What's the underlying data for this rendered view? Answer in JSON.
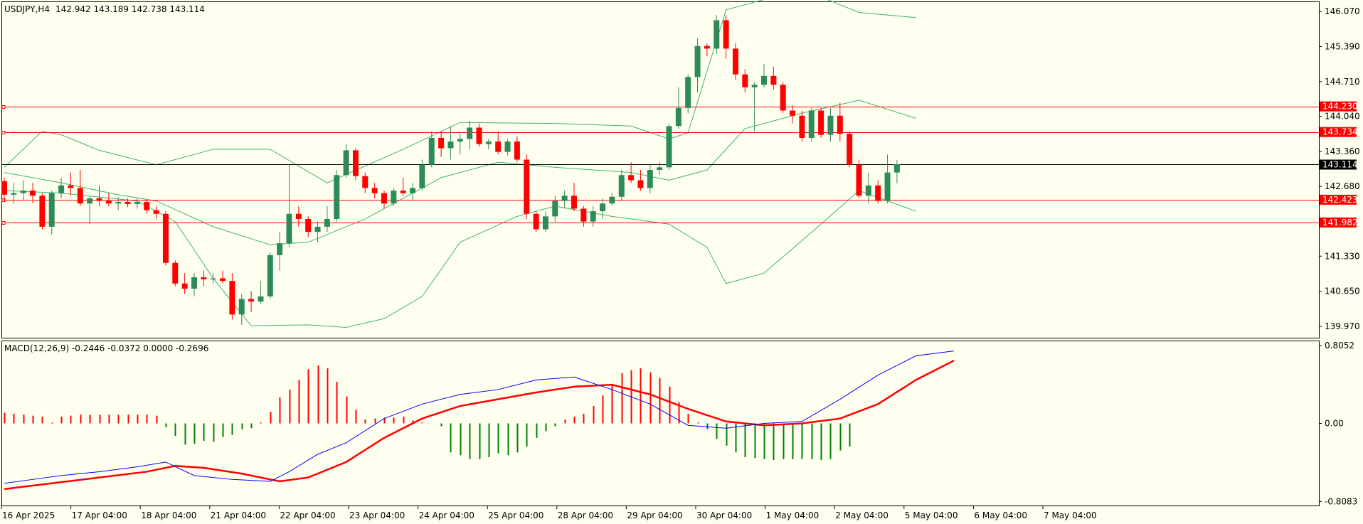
{
  "header": {
    "symbol": "USDJPY,H4",
    "ohlc": "142.942 143.189 142.738 143.114"
  },
  "colors": {
    "background": "#fffff0",
    "bull_candle": "#2e8b57",
    "bear_candle": "#ff0000",
    "bollinger": "#3cb371",
    "level_line": "#ff0000",
    "price_line": "#000000",
    "macd_line": "#0000ff",
    "signal_line": "#ff0000"
  },
  "chart_data": {
    "type": "candlestick",
    "price_axis_labels": [
      "146.070",
      "145.390",
      "144.710",
      "144.040",
      "143.360",
      "142.680",
      "141.330",
      "140.650",
      "139.970"
    ],
    "price_ylim": [
      139.75,
      146.25
    ],
    "current_price": "143.114",
    "levels": [
      "144.230",
      "143.734",
      "142.423",
      "141.982"
    ],
    "time_labels": [
      "16 Apr 2025",
      "17 Apr 04:00",
      "18 Apr 04:00",
      "21 Apr 04:00",
      "22 Apr 04:00",
      "23 Apr 04:00",
      "24 Apr 04:00",
      "25 Apr 04:00",
      "28 Apr 04:00",
      "29 Apr 04:00",
      "30 Apr 04:00",
      "1 May 04:00",
      "2 May 04:00",
      "5 May 04:00",
      "6 May 04:00",
      "7 May 04:00"
    ],
    "candles": [
      {
        "o": 142.78,
        "h": 142.85,
        "l": 142.4,
        "c": 142.52
      },
      {
        "o": 142.52,
        "h": 142.75,
        "l": 142.35,
        "c": 142.55
      },
      {
        "o": 142.55,
        "h": 142.8,
        "l": 142.4,
        "c": 142.6
      },
      {
        "o": 142.6,
        "h": 142.75,
        "l": 142.35,
        "c": 142.5
      },
      {
        "o": 142.5,
        "h": 142.55,
        "l": 141.85,
        "c": 141.9
      },
      {
        "o": 141.9,
        "h": 142.6,
        "l": 141.75,
        "c": 142.55
      },
      {
        "o": 142.55,
        "h": 142.85,
        "l": 142.45,
        "c": 142.7
      },
      {
        "o": 142.7,
        "h": 142.95,
        "l": 142.5,
        "c": 142.65
      },
      {
        "o": 142.65,
        "h": 143.0,
        "l": 142.3,
        "c": 142.35
      },
      {
        "o": 142.35,
        "h": 142.5,
        "l": 141.95,
        "c": 142.45
      },
      {
        "o": 142.45,
        "h": 142.7,
        "l": 142.3,
        "c": 142.4
      },
      {
        "o": 142.4,
        "h": 142.55,
        "l": 142.3,
        "c": 142.35
      },
      {
        "o": 142.35,
        "h": 142.48,
        "l": 142.22,
        "c": 142.38
      },
      {
        "o": 142.38,
        "h": 142.45,
        "l": 142.28,
        "c": 142.34
      },
      {
        "o": 142.34,
        "h": 142.45,
        "l": 142.25,
        "c": 142.38
      },
      {
        "o": 142.38,
        "h": 142.42,
        "l": 142.15,
        "c": 142.22
      },
      {
        "o": 142.22,
        "h": 142.3,
        "l": 142.05,
        "c": 142.15
      },
      {
        "o": 142.15,
        "h": 142.2,
        "l": 141.15,
        "c": 141.2
      },
      {
        "o": 141.2,
        "h": 141.25,
        "l": 140.75,
        "c": 140.8
      },
      {
        "o": 140.8,
        "h": 141.0,
        "l": 140.6,
        "c": 140.7
      },
      {
        "o": 140.7,
        "h": 141.0,
        "l": 140.55,
        "c": 140.92
      },
      {
        "o": 140.92,
        "h": 141.05,
        "l": 140.75,
        "c": 140.88
      },
      {
        "o": 140.88,
        "h": 141.0,
        "l": 140.8,
        "c": 140.9
      },
      {
        "o": 140.9,
        "h": 141.05,
        "l": 140.8,
        "c": 140.85
      },
      {
        "o": 140.85,
        "h": 141.0,
        "l": 140.1,
        "c": 140.2
      },
      {
        "o": 140.2,
        "h": 140.6,
        "l": 140.0,
        "c": 140.5
      },
      {
        "o": 140.5,
        "h": 140.65,
        "l": 140.25,
        "c": 140.45
      },
      {
        "o": 140.45,
        "h": 140.85,
        "l": 140.4,
        "c": 140.55
      },
      {
        "o": 140.55,
        "h": 141.4,
        "l": 140.5,
        "c": 141.35
      },
      {
        "o": 141.35,
        "h": 141.8,
        "l": 141.05,
        "c": 141.58
      },
      {
        "o": 141.58,
        "h": 143.1,
        "l": 141.5,
        "c": 142.15
      },
      {
        "o": 142.15,
        "h": 142.3,
        "l": 141.9,
        "c": 142.05
      },
      {
        "o": 142.05,
        "h": 142.1,
        "l": 141.7,
        "c": 141.8
      },
      {
        "o": 141.8,
        "h": 142.0,
        "l": 141.6,
        "c": 141.9
      },
      {
        "o": 141.9,
        "h": 142.3,
        "l": 141.8,
        "c": 142.05
      },
      {
        "o": 142.05,
        "h": 143.0,
        "l": 142.0,
        "c": 142.9
      },
      {
        "o": 142.9,
        "h": 143.5,
        "l": 142.85,
        "c": 143.38
      },
      {
        "o": 143.38,
        "h": 143.42,
        "l": 142.8,
        "c": 142.88
      },
      {
        "o": 142.88,
        "h": 142.95,
        "l": 142.55,
        "c": 142.65
      },
      {
        "o": 142.65,
        "h": 142.75,
        "l": 142.45,
        "c": 142.55
      },
      {
        "o": 142.55,
        "h": 142.6,
        "l": 142.25,
        "c": 142.35
      },
      {
        "o": 142.35,
        "h": 142.65,
        "l": 142.3,
        "c": 142.6
      },
      {
        "o": 142.6,
        "h": 142.85,
        "l": 142.5,
        "c": 142.55
      },
      {
        "o": 142.55,
        "h": 142.75,
        "l": 142.4,
        "c": 142.65
      },
      {
        "o": 142.65,
        "h": 143.2,
        "l": 142.6,
        "c": 143.1
      },
      {
        "o": 143.1,
        "h": 143.75,
        "l": 143.05,
        "c": 143.62
      },
      {
        "o": 143.62,
        "h": 143.75,
        "l": 143.25,
        "c": 143.42
      },
      {
        "o": 143.42,
        "h": 143.85,
        "l": 143.2,
        "c": 143.55
      },
      {
        "o": 143.55,
        "h": 143.7,
        "l": 143.3,
        "c": 143.6
      },
      {
        "o": 143.6,
        "h": 143.95,
        "l": 143.4,
        "c": 143.82
      },
      {
        "o": 143.82,
        "h": 143.9,
        "l": 143.45,
        "c": 143.5
      },
      {
        "o": 143.5,
        "h": 143.6,
        "l": 143.4,
        "c": 143.55
      },
      {
        "o": 143.55,
        "h": 143.75,
        "l": 143.3,
        "c": 143.35
      },
      {
        "o": 143.35,
        "h": 143.6,
        "l": 143.28,
        "c": 143.55
      },
      {
        "o": 143.55,
        "h": 143.65,
        "l": 143.15,
        "c": 143.2
      },
      {
        "o": 143.2,
        "h": 143.3,
        "l": 142.05,
        "c": 142.15
      },
      {
        "o": 142.15,
        "h": 142.2,
        "l": 141.8,
        "c": 141.85
      },
      {
        "o": 141.85,
        "h": 142.2,
        "l": 141.8,
        "c": 142.1
      },
      {
        "o": 142.1,
        "h": 142.5,
        "l": 142.0,
        "c": 142.4
      },
      {
        "o": 142.4,
        "h": 142.6,
        "l": 142.25,
        "c": 142.5
      },
      {
        "o": 142.5,
        "h": 142.75,
        "l": 142.2,
        "c": 142.25
      },
      {
        "o": 142.25,
        "h": 142.3,
        "l": 141.9,
        "c": 142.0
      },
      {
        "o": 142.0,
        "h": 142.3,
        "l": 141.9,
        "c": 142.2
      },
      {
        "o": 142.2,
        "h": 142.45,
        "l": 142.05,
        "c": 142.35
      },
      {
        "o": 142.35,
        "h": 142.55,
        "l": 142.3,
        "c": 142.48
      },
      {
        "o": 142.48,
        "h": 143.0,
        "l": 142.4,
        "c": 142.9
      },
      {
        "o": 142.9,
        "h": 143.15,
        "l": 142.75,
        "c": 142.8
      },
      {
        "o": 142.8,
        "h": 143.0,
        "l": 142.6,
        "c": 142.65
      },
      {
        "o": 142.65,
        "h": 143.1,
        "l": 142.55,
        "c": 143.0
      },
      {
        "o": 143.0,
        "h": 143.15,
        "l": 142.9,
        "c": 143.05
      },
      {
        "o": 143.05,
        "h": 143.9,
        "l": 143.0,
        "c": 143.85
      },
      {
        "o": 143.85,
        "h": 144.6,
        "l": 143.8,
        "c": 144.2
      },
      {
        "o": 144.2,
        "h": 144.85,
        "l": 144.1,
        "c": 144.8
      },
      {
        "o": 144.8,
        "h": 145.55,
        "l": 144.5,
        "c": 145.4
      },
      {
        "o": 145.4,
        "h": 145.45,
        "l": 145.2,
        "c": 145.35
      },
      {
        "o": 145.35,
        "h": 146.0,
        "l": 145.25,
        "c": 145.9
      },
      {
        "o": 145.9,
        "h": 146.0,
        "l": 145.15,
        "c": 145.35
      },
      {
        "o": 145.35,
        "h": 145.45,
        "l": 144.75,
        "c": 144.85
      },
      {
        "o": 144.85,
        "h": 144.95,
        "l": 144.5,
        "c": 144.6
      },
      {
        "o": 144.6,
        "h": 144.7,
        "l": 143.75,
        "c": 144.65
      },
      {
        "o": 144.65,
        "h": 145.05,
        "l": 144.6,
        "c": 144.82
      },
      {
        "o": 144.82,
        "h": 145.0,
        "l": 144.55,
        "c": 144.65
      },
      {
        "o": 144.65,
        "h": 144.7,
        "l": 144.1,
        "c": 144.15
      },
      {
        "o": 144.15,
        "h": 144.25,
        "l": 143.9,
        "c": 144.05
      },
      {
        "o": 144.05,
        "h": 144.15,
        "l": 143.55,
        "c": 143.62
      },
      {
        "o": 143.62,
        "h": 144.2,
        "l": 143.55,
        "c": 144.15
      },
      {
        "o": 144.15,
        "h": 144.2,
        "l": 143.62,
        "c": 143.68
      },
      {
        "o": 143.68,
        "h": 144.2,
        "l": 143.55,
        "c": 144.05
      },
      {
        "o": 144.05,
        "h": 144.3,
        "l": 143.55,
        "c": 143.7
      },
      {
        "o": 143.7,
        "h": 143.75,
        "l": 143.05,
        "c": 143.1
      },
      {
        "o": 143.1,
        "h": 143.2,
        "l": 142.45,
        "c": 142.5
      },
      {
        "o": 142.5,
        "h": 142.95,
        "l": 142.35,
        "c": 142.7
      },
      {
        "o": 142.7,
        "h": 142.8,
        "l": 142.35,
        "c": 142.4
      },
      {
        "o": 142.4,
        "h": 143.3,
        "l": 142.35,
        "c": 142.95
      },
      {
        "o": 142.95,
        "h": 143.19,
        "l": 142.74,
        "c": 143.11
      }
    ],
    "bollinger": {
      "upper": [
        [
          0,
          143.05
        ],
        [
          4,
          143.75
        ],
        [
          6,
          143.68
        ],
        [
          10,
          143.38
        ],
        [
          16,
          143.1
        ],
        [
          22,
          143.4
        ],
        [
          28,
          143.4
        ],
        [
          34,
          142.75
        ],
        [
          42,
          143.4
        ],
        [
          48,
          143.92
        ],
        [
          58,
          143.9
        ],
        [
          66,
          143.85
        ],
        [
          70,
          143.6
        ],
        [
          72,
          143.72
        ],
        [
          76,
          146.1
        ],
        [
          80,
          146.3
        ],
        [
          86,
          146.35
        ],
        [
          90,
          146.05
        ],
        [
          96,
          145.95
        ]
      ],
      "middle": [
        [
          0,
          142.95
        ],
        [
          6,
          142.75
        ],
        [
          12,
          142.52
        ],
        [
          16,
          142.4
        ],
        [
          22,
          141.9
        ],
        [
          28,
          141.55
        ],
        [
          32,
          141.6
        ],
        [
          38,
          142.05
        ],
        [
          46,
          142.85
        ],
        [
          52,
          143.15
        ],
        [
          58,
          143.05
        ],
        [
          66,
          142.95
        ],
        [
          70,
          142.8
        ],
        [
          74,
          143.0
        ],
        [
          78,
          143.8
        ],
        [
          84,
          144.1
        ],
        [
          90,
          144.35
        ],
        [
          96,
          144.0
        ]
      ],
      "lower": [
        [
          0,
          142.6
        ],
        [
          6,
          142.55
        ],
        [
          14,
          142.4
        ],
        [
          18,
          142.0
        ],
        [
          22,
          140.9
        ],
        [
          26,
          139.98
        ],
        [
          32,
          140.0
        ],
        [
          36,
          139.95
        ],
        [
          40,
          140.12
        ],
        [
          44,
          140.55
        ],
        [
          48,
          141.6
        ],
        [
          54,
          142.1
        ],
        [
          58,
          142.3
        ],
        [
          64,
          142.1
        ],
        [
          70,
          141.95
        ],
        [
          74,
          141.5
        ],
        [
          76,
          140.8
        ],
        [
          80,
          141.0
        ],
        [
          86,
          141.95
        ],
        [
          90,
          142.6
        ],
        [
          96,
          142.2
        ]
      ]
    },
    "macd_axis_labels": [
      "0.8052",
      "0.00",
      "-0.8083"
    ],
    "macd_ylim": [
      -0.85,
      0.85
    ],
    "macd_label": "MACD(12,26,9) -0.2446 -0.0372 0.0000 -0.2696",
    "macd": {
      "main": [
        [
          0,
          -0.62
        ],
        [
          3,
          -0.58
        ],
        [
          6,
          -0.54
        ],
        [
          10,
          -0.5
        ],
        [
          14,
          -0.45
        ],
        [
          17,
          -0.4
        ],
        [
          20,
          -0.54
        ],
        [
          24,
          -0.58
        ],
        [
          28,
          -0.6
        ],
        [
          30,
          -0.5
        ],
        [
          33,
          -0.32
        ],
        [
          36,
          -0.2
        ],
        [
          40,
          0.05
        ],
        [
          44,
          0.2
        ],
        [
          48,
          0.3
        ],
        [
          52,
          0.35
        ],
        [
          56,
          0.45
        ],
        [
          60,
          0.48
        ],
        [
          64,
          0.35
        ],
        [
          68,
          0.2
        ],
        [
          72,
          -0.02
        ],
        [
          76,
          -0.05
        ],
        [
          80,
          0.0
        ],
        [
          84,
          0.02
        ],
        [
          88,
          0.25
        ],
        [
          92,
          0.5
        ],
        [
          96,
          0.7
        ],
        [
          100,
          0.75
        ]
      ],
      "signal": [
        [
          0,
          -0.68
        ],
        [
          5,
          -0.62
        ],
        [
          10,
          -0.56
        ],
        [
          15,
          -0.5
        ],
        [
          18,
          -0.44
        ],
        [
          21,
          -0.46
        ],
        [
          25,
          -0.52
        ],
        [
          29,
          -0.6
        ],
        [
          32,
          -0.56
        ],
        [
          36,
          -0.4
        ],
        [
          40,
          -0.15
        ],
        [
          44,
          0.05
        ],
        [
          48,
          0.18
        ],
        [
          52,
          0.25
        ],
        [
          56,
          0.32
        ],
        [
          60,
          0.38
        ],
        [
          64,
          0.4
        ],
        [
          68,
          0.3
        ],
        [
          72,
          0.15
        ],
        [
          76,
          0.02
        ],
        [
          80,
          -0.02
        ],
        [
          84,
          0.0
        ],
        [
          88,
          0.05
        ],
        [
          92,
          0.2
        ],
        [
          96,
          0.45
        ],
        [
          100,
          0.65
        ]
      ],
      "histogram": [
        0.11,
        0.1,
        0.09,
        0.08,
        0.07,
        0.01,
        0.07,
        0.08,
        0.09,
        0.09,
        0.09,
        0.09,
        0.09,
        0.09,
        0.09,
        0.09,
        0.08,
        -0.04,
        -0.13,
        -0.22,
        -0.21,
        -0.18,
        -0.19,
        -0.14,
        -0.12,
        -0.06,
        -0.05,
        0.01,
        0.12,
        0.27,
        0.35,
        0.45,
        0.56,
        0.6,
        0.57,
        0.43,
        0.28,
        0.14,
        0.04,
        0.05,
        0.06,
        0.06,
        0.07,
        0.03,
        0.01,
        0.0,
        -0.03,
        -0.3,
        -0.33,
        -0.37,
        -0.37,
        -0.35,
        -0.31,
        -0.33,
        -0.3,
        -0.24,
        -0.15,
        -0.08,
        -0.03,
        0.04,
        0.07,
        0.1,
        0.18,
        0.29,
        0.4,
        0.52,
        0.55,
        0.57,
        0.53,
        0.47,
        0.38,
        0.22,
        0.1,
        0.01,
        -0.06,
        -0.16,
        -0.23,
        -0.3,
        -0.35,
        -0.36,
        -0.37,
        -0.38,
        -0.37,
        -0.37,
        -0.37,
        -0.37,
        -0.38,
        -0.37,
        -0.28,
        -0.24
      ]
    }
  }
}
